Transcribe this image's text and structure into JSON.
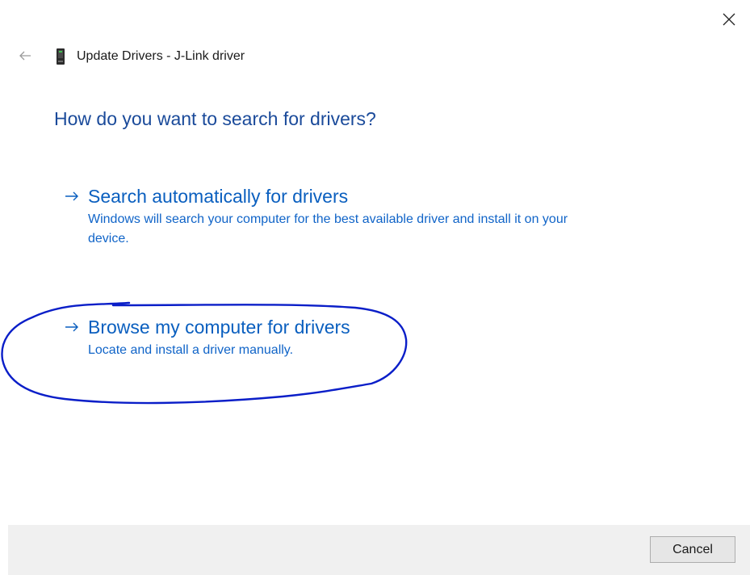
{
  "window": {
    "title": "Update Drivers - J-Link driver",
    "close_icon": "close-icon",
    "back_icon": "back-arrow-icon",
    "device_icon": "device-icon"
  },
  "main": {
    "heading": "How do you want to search for drivers?",
    "options": [
      {
        "title": "Search automatically for drivers",
        "description": "Windows will search your computer for the best available driver and install it on your device.",
        "icon": "arrow-right-icon"
      },
      {
        "title": "Browse my computer for drivers",
        "description": "Locate and install a driver manually.",
        "icon": "arrow-right-icon"
      }
    ]
  },
  "footer": {
    "cancel_label": "Cancel"
  },
  "colors": {
    "heading": "#1a4a9a",
    "option_link": "#0a5fbf",
    "annotation": "#0a1ec8",
    "footer_bg": "#f0f0f0"
  }
}
